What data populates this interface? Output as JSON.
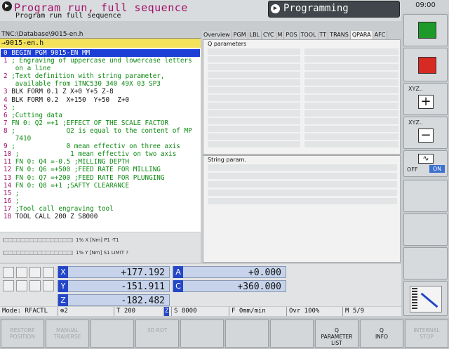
{
  "header": {
    "mode_title": "Program run, full sequence",
    "mode_subtitle": "Program run full sequence",
    "programming_label": "Programming",
    "clock": "09:00"
  },
  "program": {
    "path": "TNC:\\Database\\9015-en.h",
    "file_tab": "→9015-en.h",
    "lines": [
      {
        "n": "0",
        "t": " BEGIN PGM 9015-EN MM",
        "sel": true
      },
      {
        "n": "1",
        "t": " ; Engraving of uppercase und lowercase letters"
      },
      {
        "n": "",
        "t": "   on a line"
      },
      {
        "n": "2",
        "t": " ;Text definition with string parameter,"
      },
      {
        "n": "",
        "t": "   available from iTNC530 340 49X 03 SP3"
      },
      {
        "n": "3",
        "t": " BLK FORM 0.1 Z X+0 Y+5 Z-8",
        "k": true
      },
      {
        "n": "4",
        "t": " BLK FORM 0.2  X+150  Y+50  Z+0",
        "k": true
      },
      {
        "n": "5",
        "t": " ;"
      },
      {
        "n": "6",
        "t": " ;Cutting data"
      },
      {
        "n": "7",
        "t": " FN 0: Q2 =+1 ;EFFECT OF THE SCALE FACTOR"
      },
      {
        "n": "8",
        "t": " ;             Q2 is equal to the content of MP"
      },
      {
        "n": "",
        "t": "   7410"
      },
      {
        "n": "9",
        "t": " ;             0 mean effectiv on three axis"
      },
      {
        "n": "10",
        "t": " ;             1 mean effectiv on two axis"
      },
      {
        "n": "11",
        "t": " FN 0: Q4 =-0.5 ;MILLING DEPTH"
      },
      {
        "n": "12",
        "t": " FN 0: Q6 =+500 ;FEED RATE FOR MILLING"
      },
      {
        "n": "13",
        "t": " FN 0: Q7 =+200 ;FEED RATE FOR PLUNGING"
      },
      {
        "n": "14",
        "t": " FN 0: Q8 =+1 ;SAFTY CLEARANCE"
      },
      {
        "n": "15",
        "t": " ;"
      },
      {
        "n": "16",
        "t": " ;"
      },
      {
        "n": "17",
        "t": " ;Tool call engraving tool"
      },
      {
        "n": "18",
        "t": " TOOL CALL 200 Z S8000",
        "k": true
      }
    ]
  },
  "mini_status": {
    "row1": "1% X [Nm]  P1  -T1",
    "row2": "1% Y [Nm]  S1  LIMIT ?"
  },
  "tabs": [
    "Overview",
    "PGM",
    "LBL",
    "CYC",
    "M",
    "POS",
    "TOOL",
    "TT",
    "TRANS",
    "QPARA",
    "AFC"
  ],
  "active_tab": "QPARA",
  "qpanel": {
    "title": "Q parameters"
  },
  "spanel": {
    "title": "String param."
  },
  "positions": {
    "x": {
      "label": "X",
      "value": "+177.192"
    },
    "y": {
      "label": "Y",
      "value": "-151.911"
    },
    "z": {
      "label": "Z",
      "value": "-182.482"
    },
    "a": {
      "label": "A",
      "value": "+0.000"
    },
    "c": {
      "label": "C",
      "value": "+360.000"
    }
  },
  "status": {
    "mode": "Mode: RFACTL",
    "datum": "2",
    "tool": "T 200",
    "axis": "Z",
    "spindle": "S 8000",
    "feed": "F 0mm/min",
    "override": "Ovr 100%",
    "mfunc": "M 5/9"
  },
  "vkeys": {
    "xyz_plus": "XYZ..",
    "xyz_minus": "XYZ..",
    "off": "OFF",
    "on": "ON"
  },
  "softkeys": [
    {
      "label": "RESTORE\nPOSITION",
      "on": false
    },
    {
      "label": "MANUAL\nTRAVERSE",
      "on": false
    },
    {
      "label": "",
      "on": false
    },
    {
      "label": "3D ROT",
      "on": false
    },
    {
      "label": "",
      "on": false
    },
    {
      "label": "",
      "on": false
    },
    {
      "label": "",
      "on": false
    },
    {
      "label": "Q\nPARAMETER\nLIST",
      "on": true
    },
    {
      "label": "Q\nINFO",
      "on": true
    },
    {
      "label": "INTERNAL\nSTOP",
      "on": false
    }
  ]
}
